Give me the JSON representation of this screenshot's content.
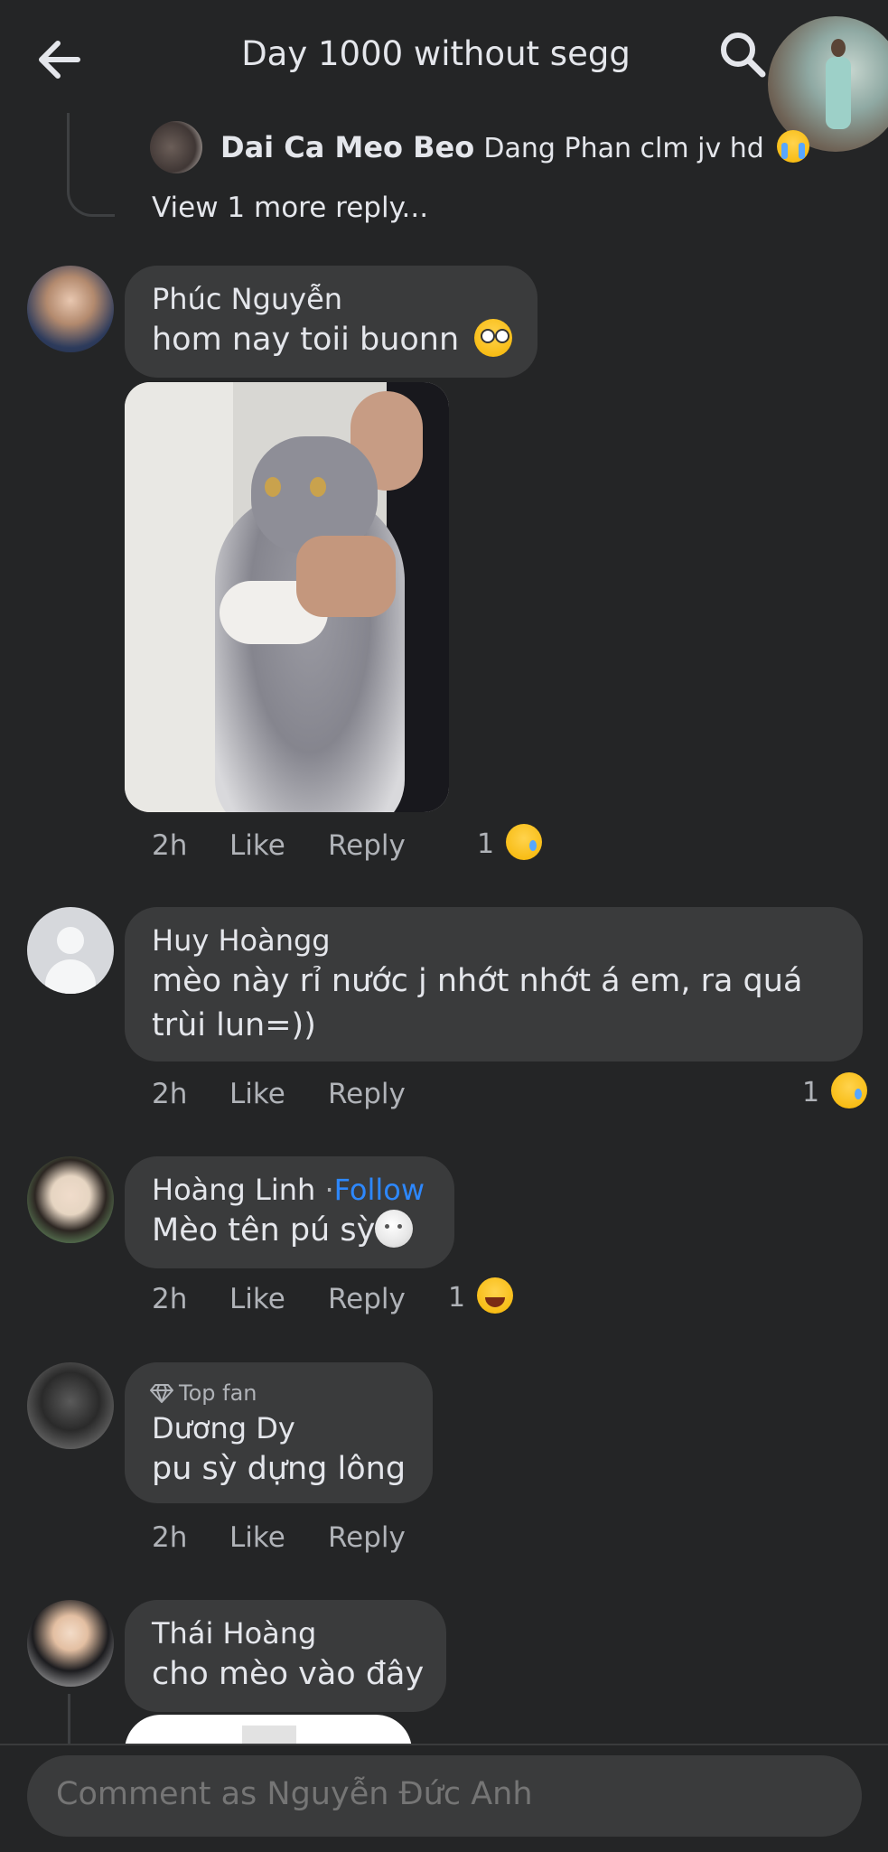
{
  "header": {
    "title": "Day 1000 without segg"
  },
  "reply_preview": {
    "author": "Dai Ca Meo Beo",
    "text": "Dang Phan clm jv hd",
    "view_more": "View 1 more reply..."
  },
  "comments": [
    {
      "author": "Phúc Nguyễn",
      "text": "hom nay toii buonn",
      "time": "2h",
      "like": "Like",
      "reply": "Reply",
      "reaction_count": "1"
    },
    {
      "author": "Huy Hoàngg",
      "text_line1": "mèo này rỉ nước j nhớt nhớt á em, ra quá",
      "text_line2": "trùi lun=))",
      "time": "2h",
      "like": "Like",
      "reply": "Reply",
      "reaction_count": "1"
    },
    {
      "author": "Hoàng Linh",
      "follow": "Follow",
      "separator": "·",
      "text": "Mèo tên pú sỳ",
      "time": "2h",
      "like": "Like",
      "reply": "Reply",
      "reaction_count": "1"
    },
    {
      "badge": "Top fan",
      "author": "Dương Dy",
      "text": "pu sỳ dựng lông",
      "time": "2h",
      "like": "Like",
      "reply": "Reply"
    },
    {
      "author": "Thái Hoàng",
      "text": "cho mèo vào đây"
    }
  ],
  "composer": {
    "placeholder": "Comment as Nguyễn Đức Anh"
  },
  "colors": {
    "background": "#242526",
    "bubble": "#3a3b3c",
    "text": "#e4e6eb",
    "muted": "#b0b3b8",
    "link": "#2d88ff"
  },
  "icons": [
    "back-arrow-icon",
    "search-icon",
    "crying-face-emoji",
    "pleading-face-emoji",
    "sad-emoji",
    "moon-face-emoji",
    "laughing-emoji",
    "diamond-icon"
  ]
}
